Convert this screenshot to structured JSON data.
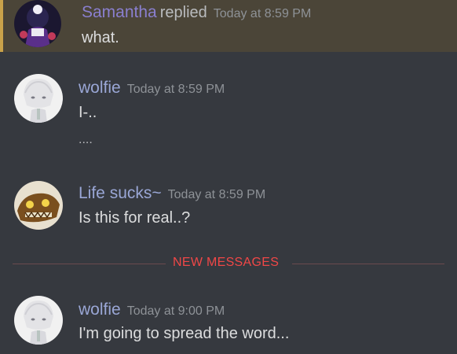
{
  "messages": [
    {
      "author": "Samantha",
      "action": "replied",
      "timestamp": "Today at 8:59 PM",
      "lines": [
        "what."
      ],
      "author_color": "#8a7fcf",
      "highlighted": true
    },
    {
      "author": "wolfie",
      "timestamp": "Today at 8:59 PM",
      "lines": [
        "I-..",
        "...."
      ],
      "author_color": "#9aa7d6"
    },
    {
      "author": "Life sucks~",
      "timestamp": "Today at 8:59 PM",
      "lines": [
        "Is this for real..?"
      ],
      "author_color": "#9aa7d6"
    },
    {
      "author": "wolfie",
      "timestamp": "Today at 9:00 PM",
      "lines": [
        "I'm going to spread the word..."
      ],
      "author_color": "#9aa7d6"
    }
  ],
  "new_messages_label": "NEW MESSAGES",
  "colors": {
    "background": "#36393f",
    "highlight_bg": "#4b4538",
    "highlight_border": "#c9a24a",
    "new_messages": "#f04747"
  }
}
